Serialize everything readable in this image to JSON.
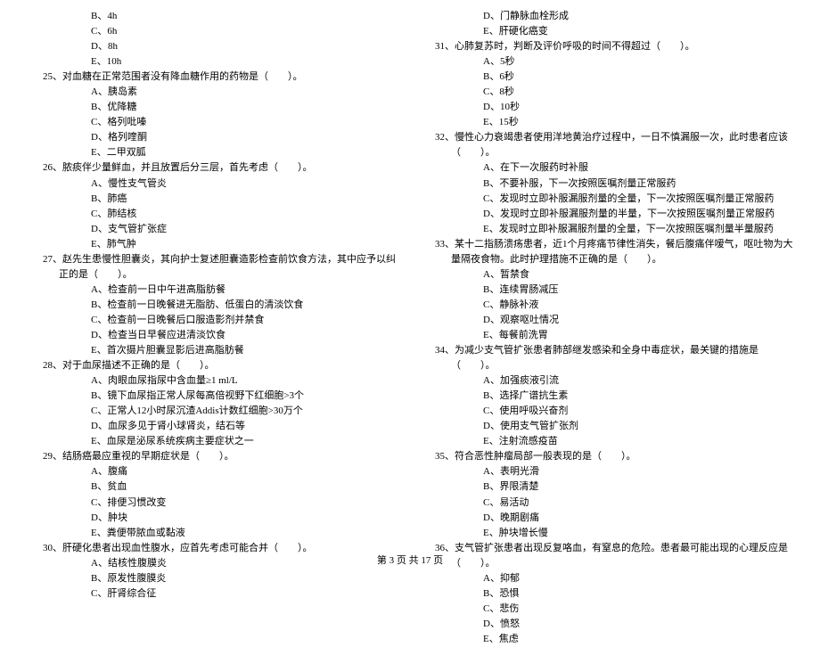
{
  "left": {
    "pre_opts": [
      "B、4h",
      "C、6h",
      "D、8h",
      "E、10h"
    ],
    "q25": {
      "text": "25、对血糖在正常范围者没有降血糖作用的药物是（　　）。",
      "opts": [
        "A、胰岛素",
        "B、优降糖",
        "C、格列吡嗪",
        "D、格列喹酮",
        "E、二甲双胍"
      ]
    },
    "q26": {
      "text": "26、脓痰伴少量鲜血，并且放置后分三层，首先考虑（　　）。",
      "opts": [
        "A、慢性支气管炎",
        "B、肺癌",
        "C、肺结核",
        "D、支气管扩张症",
        "E、肺气肿"
      ]
    },
    "q27": {
      "text": "27、赵先生患慢性胆囊炎，其向护士复述胆囊造影检查前饮食方法，其中应予以纠正的是（　　）。",
      "opts": [
        "A、检查前一日中午进高脂肪餐",
        "B、检查前一日晚餐进无脂肪、低蛋白的清淡饮食",
        "C、检查前一日晚餐后口服造影剂并禁食",
        "D、检查当日早餐应进清淡饮食",
        "E、首次摄片胆囊显影后进高脂肪餐"
      ]
    },
    "q28": {
      "text": "28、对于血尿描述不正确的是（　　）。",
      "opts": [
        "A、肉眼血尿指尿中含血量≥1 ml/L",
        "B、镜下血尿指正常人尿每高倍视野下红细胞>3个",
        "C、正常人12小时尿沉渣Addis计数红细胞>30万个",
        "D、血尿多见于肾小球肾炎，结石等",
        "E、血尿是泌尿系统疾病主要症状之一"
      ]
    },
    "q29": {
      "text": "29、结肠癌最应重视的早期症状是（　　）。",
      "opts": [
        "A、腹痛",
        "B、贫血",
        "C、排便习惯改变",
        "D、肿块",
        "E、粪便带脓血或黏液"
      ]
    },
    "q30": {
      "text": "30、肝硬化患者出现血性腹水，应首先考虑可能合并（　　）。",
      "opts": [
        "A、结核性腹膜炎",
        "B、原发性腹膜炎",
        "C、肝肾综合征"
      ]
    }
  },
  "right": {
    "pre_opts": [
      "D、门静脉血栓形成",
      "E、肝硬化癌变"
    ],
    "q31": {
      "text": "31、心肺复苏时，判断及评价呼吸的时间不得超过（　　）。",
      "opts": [
        "A、5秒",
        "B、6秒",
        "C、8秒",
        "D、10秒",
        "E、15秒"
      ]
    },
    "q32": {
      "text": "32、慢性心力衰竭患者使用洋地黄治疗过程中，一日不慎漏服一次，此时患者应该（　　）。",
      "opts": [
        "A、在下一次服药时补服",
        "B、不要补服，下一次按照医嘱剂量正常服药",
        "C、发现时立即补服漏服剂量的全量，下一次按照医嘱剂量正常服药",
        "D、发现时立即补服漏服剂量的半量，下一次按照医嘱剂量正常服药",
        "E、发现时立即补服漏服剂量的全量，下一次按照医嘱剂量半量服药"
      ]
    },
    "q33": {
      "text": "33、某十二指肠溃疡患者，近1个月疼痛节律性消失，餐后腹痛伴嗳气，呕吐物为大量隔夜食物。此时护理措施不正确的是（　　）。",
      "opts": [
        "A、暂禁食",
        "B、连续胃肠减压",
        "C、静脉补液",
        "D、观察呕吐情况",
        "E、每餐前洗胃"
      ]
    },
    "q34": {
      "text": "34、为减少支气管扩张患者肺部继发感染和全身中毒症状，最关键的措施是（　　）。",
      "opts": [
        "A、加强痰液引流",
        "B、选择广谱抗生素",
        "C、使用呼吸兴奋剂",
        "D、使用支气管扩张剂",
        "E、注射流感疫苗"
      ]
    },
    "q35": {
      "text": "35、符合恶性肿瘤局部一般表现的是（　　）。",
      "opts": [
        "A、表明光滑",
        "B、界限清楚",
        "C、易活动",
        "D、晚期剧痛",
        "E、肿块增长慢"
      ]
    },
    "q36": {
      "text": "36、支气管扩张患者出现反复咯血，有窒息的危险。患者最可能出现的心理反应是（　　）。",
      "opts": [
        "A、抑郁",
        "B、恐惧",
        "C、悲伤",
        "D、愤怒",
        "E、焦虑"
      ]
    }
  },
  "footer": "第 3 页 共 17 页"
}
